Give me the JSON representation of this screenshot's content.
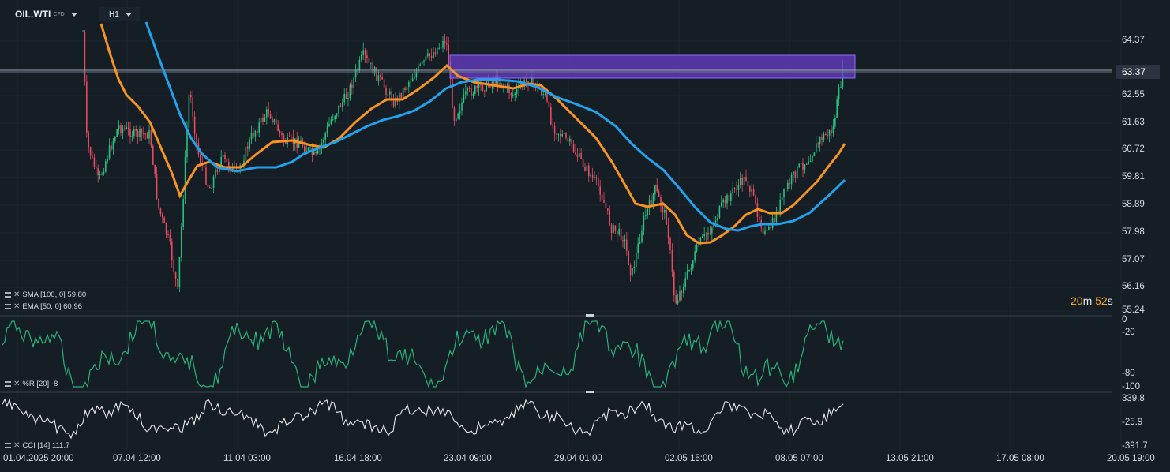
{
  "header": {
    "symbol": "OIL.WTI",
    "symbol_tag": "CFD",
    "timeframe": "H1"
  },
  "indicators": {
    "sma": "SMA [100,  0]  59.80",
    "ema": "EMA [50,  0]  60.96",
    "wpr": "%R [20]  -8",
    "cci": "CCI [14]  111.7"
  },
  "price_axis": [
    "64.37",
    "63.37",
    "62.55",
    "61.63",
    "60.72",
    "59.81",
    "58.89",
    "57.98",
    "57.07",
    "56.16",
    "55.24"
  ],
  "wpr_axis": [
    "0",
    "-20",
    "-80",
    "-100"
  ],
  "cci_axis": [
    "339.8",
    "-25.9",
    "-391.7"
  ],
  "time_axis": [
    "01.04.2025  20:00",
    "07.04  12:00",
    "11.04  03:00",
    "16.04  18:00",
    "23.04  09:00",
    "29.04  01:00",
    "02.05  15:00",
    "08.05  07:00",
    "13.05  21:00",
    "17.05  08:00",
    "20.05  19:00"
  ],
  "current_price": "63.37",
  "countdown": {
    "minutes": "20",
    "minutes_unit": "m",
    "seconds": "52",
    "seconds_unit": "s"
  },
  "colors": {
    "background": "#151d25",
    "bull_candle": "#26c281",
    "bear_candle": "#e84a5f",
    "sma": "#1fa3ec",
    "ema": "#f7931e",
    "zone": "#6a3ec8",
    "wpr_line": "#25b27a",
    "cci_line": "#e8e8e8"
  },
  "icons": {
    "indicator_settings": "settings-lines-icon",
    "indicator_remove": "close-icon",
    "dropdown": "chevron-down-icon"
  }
}
